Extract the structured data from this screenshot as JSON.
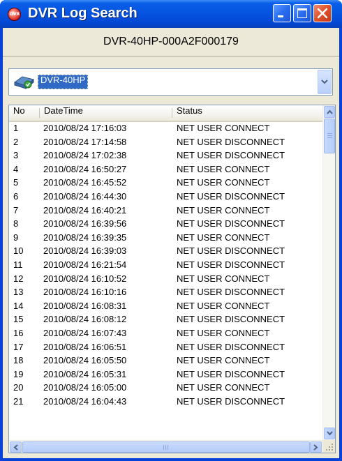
{
  "window": {
    "title": "DVR Log Search",
    "icon_text": "DVR",
    "icon": "dvr-app-icon",
    "controls": [
      "minimize-icon",
      "maximize-icon",
      "close-icon"
    ]
  },
  "device": {
    "name": "DVR-40HP-000A2F000179"
  },
  "combo": {
    "selected": "DVR-40HP",
    "icon": "dvr-device-icon"
  },
  "table": {
    "headers": {
      "no": "No",
      "datetime": "DateTime",
      "status": "Status"
    },
    "rows": [
      {
        "no": "1",
        "datetime": "2010/08/24 17:16:03",
        "status": "NET USER CONNECT"
      },
      {
        "no": "2",
        "datetime": "2010/08/24 17:14:58",
        "status": "NET USER DISCONNECT"
      },
      {
        "no": "3",
        "datetime": "2010/08/24 17:02:38",
        "status": "NET USER DISCONNECT"
      },
      {
        "no": "4",
        "datetime": "2010/08/24 16:50:27",
        "status": "NET USER CONNECT"
      },
      {
        "no": "5",
        "datetime": "2010/08/24 16:45:52",
        "status": "NET USER CONNECT"
      },
      {
        "no": "6",
        "datetime": "2010/08/24 16:44:30",
        "status": "NET USER DISCONNECT"
      },
      {
        "no": "7",
        "datetime": "2010/08/24 16:40:21",
        "status": "NET USER CONNECT"
      },
      {
        "no": "8",
        "datetime": "2010/08/24 16:39:56",
        "status": "NET USER DISCONNECT"
      },
      {
        "no": "9",
        "datetime": "2010/08/24 16:39:35",
        "status": "NET USER CONNECT"
      },
      {
        "no": "10",
        "datetime": "2010/08/24 16:39:03",
        "status": "NET USER DISCONNECT"
      },
      {
        "no": "11",
        "datetime": "2010/08/24 16:21:54",
        "status": "NET USER DISCONNECT"
      },
      {
        "no": "12",
        "datetime": "2010/08/24 16:10:52",
        "status": "NET USER CONNECT"
      },
      {
        "no": "13",
        "datetime": "2010/08/24 16:10:16",
        "status": "NET USER DISCONNECT"
      },
      {
        "no": "14",
        "datetime": "2010/08/24 16:08:31",
        "status": "NET USER CONNECT"
      },
      {
        "no": "15",
        "datetime": "2010/08/24 16:08:12",
        "status": "NET USER DISCONNECT"
      },
      {
        "no": "16",
        "datetime": "2010/08/24 16:07:43",
        "status": "NET USER CONNECT"
      },
      {
        "no": "17",
        "datetime": "2010/08/24 16:06:51",
        "status": "NET USER DISCONNECT"
      },
      {
        "no": "18",
        "datetime": "2010/08/24 16:05:50",
        "status": "NET USER CONNECT"
      },
      {
        "no": "19",
        "datetime": "2010/08/24 16:05:31",
        "status": "NET USER DISCONNECT"
      },
      {
        "no": "20",
        "datetime": "2010/08/24 16:05:00",
        "status": "NET USER CONNECT"
      },
      {
        "no": "21",
        "datetime": "2010/08/24 16:04:43",
        "status": "NET USER DISCONNECT"
      }
    ]
  },
  "colors": {
    "titlebar": "#0553e0",
    "selection": "#316ac5",
    "client_bg": "#ece9d8",
    "close_button": "#e0502a"
  }
}
